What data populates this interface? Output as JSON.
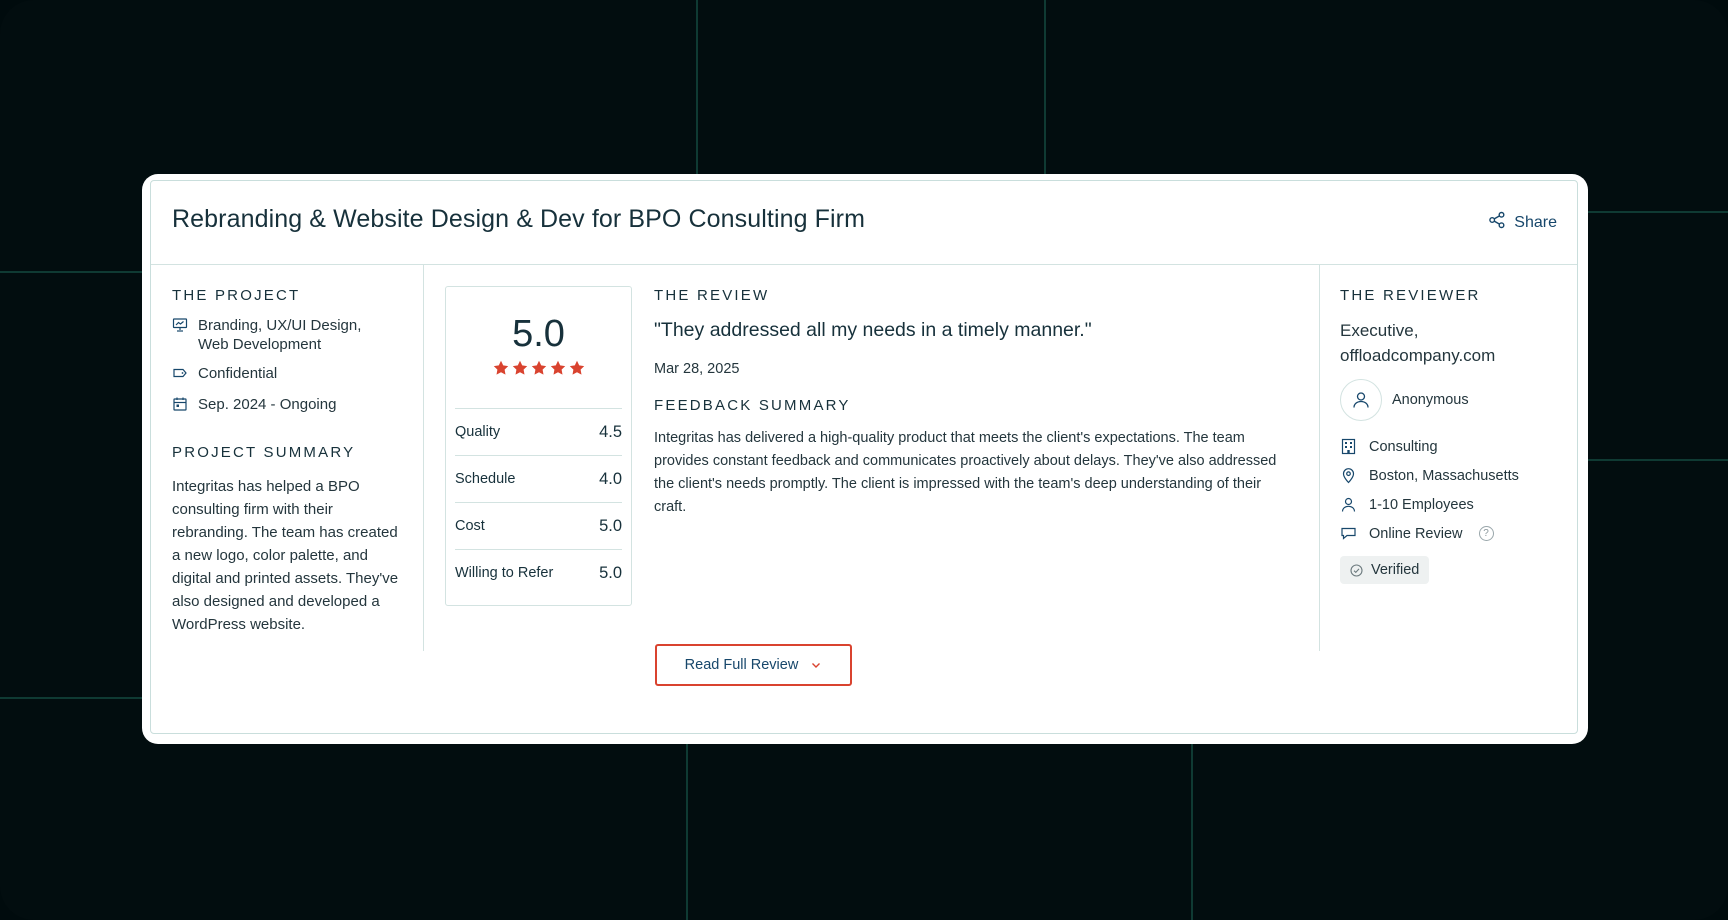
{
  "header": {
    "title": "Rebranding & Website Design & Dev for BPO Consulting Firm",
    "share_label": "Share"
  },
  "project": {
    "section_label": "THE PROJECT",
    "services": [
      "Branding, UX/UI Design,",
      "Web Development"
    ],
    "budget": "Confidential",
    "timeline": "Sep. 2024 - Ongoing",
    "summary_label": "PROJECT SUMMARY",
    "summary": "Integritas has helped a BPO consulting firm with their rebranding. The team has created a new logo, color palette, and digital and printed assets. They've also designed and developed a WordPress website."
  },
  "ratings": {
    "overall": "5.0",
    "stars": 5,
    "rows": [
      {
        "label": "Quality",
        "value": "4.5"
      },
      {
        "label": "Schedule",
        "value": "4.0"
      },
      {
        "label": "Cost",
        "value": "5.0"
      },
      {
        "label": "Willing to Refer",
        "value": "5.0"
      }
    ]
  },
  "review": {
    "section_label": "THE REVIEW",
    "quote": "\"They addressed all my needs in a timely manner.\"",
    "date": "Mar 28, 2025",
    "feedback_label": "FEEDBACK SUMMARY",
    "feedback": "Integritas has delivered a high-quality product that meets the client's expectations. The team provides constant feedback and communicates proactively about delays. They've also addressed the client's needs promptly. The client is impressed with the team's deep understanding of their craft."
  },
  "reviewer": {
    "section_label": "THE REVIEWER",
    "role_line1": "Executive,",
    "role_line2": "offloadcompany.com",
    "name": "Anonymous",
    "industry": "Consulting",
    "location": "Boston, Massachusetts",
    "size": "1-10 Employees",
    "review_type": "Online Review",
    "help_glyph": "?",
    "verified": "Verified"
  },
  "cta": {
    "read_full_label": "Read Full Review"
  },
  "colors": {
    "accent_red": "#d9432f",
    "navy": "#17476b",
    "star": "#d9432f"
  }
}
